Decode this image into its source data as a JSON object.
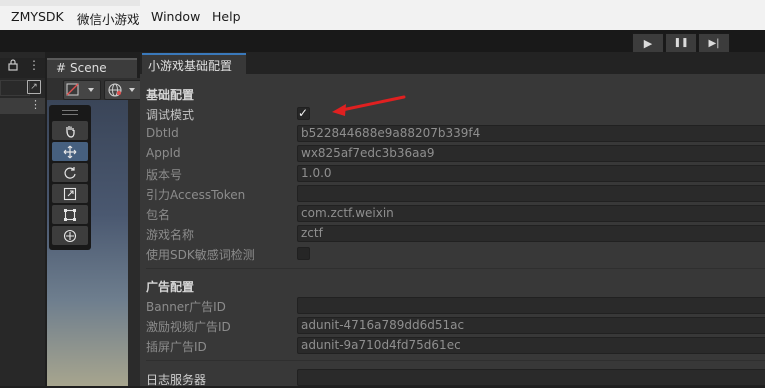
{
  "menu": {
    "items": [
      "ZMYSDK",
      "微信小游戏",
      "Window",
      "Help"
    ]
  },
  "playbar": {
    "play": "▶",
    "pause": "❚❚",
    "step": "▶|"
  },
  "left_panel": {
    "lock_icon": "lock-icon",
    "menu_dots": "⋮"
  },
  "scene": {
    "tab_label": "Scene",
    "tab_icon": "#"
  },
  "inspector": {
    "tab_label": "小游戏基础配置",
    "sections": {
      "basic": {
        "header": "基础配置",
        "debug_mode_label": "调试模式",
        "debug_mode_checked": true,
        "dbtid_label": "DbtId",
        "dbtid_value": "b522844688e9a88207b339f4",
        "appid_label": "AppId",
        "appid_value": "wx825af7edc3b36aa9",
        "version_label": "版本号",
        "version_value": "1.0.0",
        "access_token_label": "引力AccessToken",
        "access_token_value": "",
        "package_label": "包名",
        "package_value": "com.zctf.weixin",
        "game_name_label": "游戏名称",
        "game_name_value": "zctf",
        "sensitive_label": "使用SDK敏感词检测",
        "sensitive_checked": false
      },
      "ads": {
        "header": "广告配置",
        "banner_label": "Banner广告ID",
        "banner_value": "",
        "rewarded_label": "激励视频广告ID",
        "rewarded_value": "adunit-4716a789dd6d51ac",
        "interstitial_label": "插屏广告ID",
        "interstitial_value": "adunit-9a710d4fd75d61ec"
      },
      "log": {
        "server_label": "日志服务器",
        "server_value": ""
      }
    }
  },
  "colors": {
    "accent_tab": "#3a79bb",
    "annotation_arrow": "#e02020",
    "inspector_bg": "#383838"
  }
}
